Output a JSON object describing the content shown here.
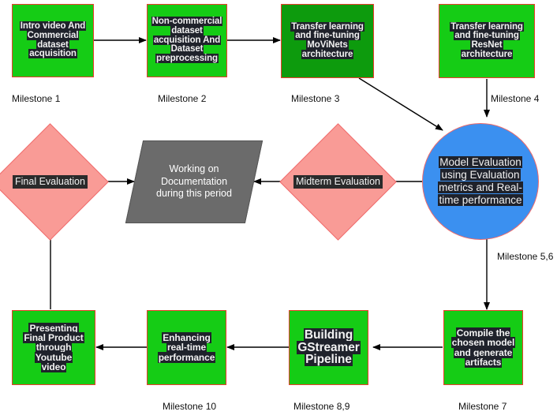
{
  "diagram": {
    "title": "Project milestone flowchart",
    "colors": {
      "box_fill": "#15cc15",
      "box_fill_dark": "#0d9b0d",
      "box_border": "#ef3b2c",
      "circle_fill": "#3b90f0",
      "circle_border": "#ef6a6a",
      "diamond_fill": "#f99b96",
      "diamond_border": "#ef6a6a",
      "parallelogram_fill": "#6b6b6b",
      "text_highlight": "#1f222b",
      "text_color": "#f2f2f2",
      "edge_color": "#000000",
      "label_color": "#111111"
    },
    "nodes": {
      "intro_dataset": {
        "shape": "rectangle",
        "lines": [
          "Intro video And",
          "Commercial",
          "dataset",
          "acquisition"
        ]
      },
      "noncommercial_dataset": {
        "shape": "rectangle",
        "lines": [
          "Non-commercial",
          "dataset",
          "acquisition And",
          "Dataset",
          "preprocessing"
        ]
      },
      "movinets": {
        "shape": "rectangle",
        "lines": [
          "Transfer learning",
          "and fine-tuning",
          "MoViNets",
          "architecture"
        ]
      },
      "resnet": {
        "shape": "rectangle",
        "lines": [
          "Transfer learning",
          "and fine-tuning",
          "ResNet",
          "architecture"
        ]
      },
      "model_evaluation": {
        "shape": "circle",
        "lines": [
          "Model Evaluation",
          "using Evaluation",
          "metrics and Real-",
          "time performance"
        ]
      },
      "midterm_evaluation": {
        "shape": "diamond",
        "label": "Midterm Evaluation"
      },
      "final_evaluation": {
        "shape": "diamond",
        "label": "Final Evaluation"
      },
      "documentation": {
        "shape": "parallelogram",
        "lines": [
          "Working on Documentation",
          "during this period"
        ]
      },
      "compile_model": {
        "shape": "rectangle",
        "lines": [
          "Compile the",
          "chosen model",
          "and generate",
          "artifacts"
        ]
      },
      "gstreamer": {
        "shape": "rectangle",
        "lines": [
          "Building",
          "GStreamer",
          "Pipeline"
        ]
      },
      "enhancing": {
        "shape": "rectangle",
        "lines": [
          "Enhancing",
          "real-time",
          "performance"
        ]
      },
      "presenting": {
        "shape": "rectangle",
        "lines": [
          "Presenting",
          "Final Product",
          "through",
          "Youtube",
          "video"
        ]
      }
    },
    "milestone_labels": {
      "m1": "Milestone 1",
      "m2": "Milestone 2",
      "m3": "Milestone 3",
      "m4": "Milestone 4",
      "m56": "Milestone 5,6",
      "m7": "Milestone 7",
      "m89": "Milestone 8,9",
      "m10": "Milestone 10"
    },
    "edges": [
      {
        "from": "intro_dataset",
        "to": "noncommercial_dataset",
        "direction": "right"
      },
      {
        "from": "noncommercial_dataset",
        "to": "movinets",
        "direction": "right"
      },
      {
        "from": "movinets",
        "to": "model_evaluation",
        "direction": "diagonal-down-right"
      },
      {
        "from": "resnet",
        "to": "model_evaluation",
        "direction": "down"
      },
      {
        "from": "model_evaluation",
        "to": "midterm_evaluation",
        "direction": "left"
      },
      {
        "from": "midterm_evaluation",
        "to": "documentation",
        "direction": "left"
      },
      {
        "from": "final_evaluation",
        "to": "documentation",
        "direction": "right"
      },
      {
        "from": "model_evaluation",
        "to": "compile_model",
        "direction": "down"
      },
      {
        "from": "compile_model",
        "to": "gstreamer",
        "direction": "left"
      },
      {
        "from": "gstreamer",
        "to": "enhancing",
        "direction": "left"
      },
      {
        "from": "enhancing",
        "to": "presenting",
        "direction": "left"
      },
      {
        "from": "presenting",
        "to": "final_evaluation",
        "direction": "up"
      }
    ]
  }
}
